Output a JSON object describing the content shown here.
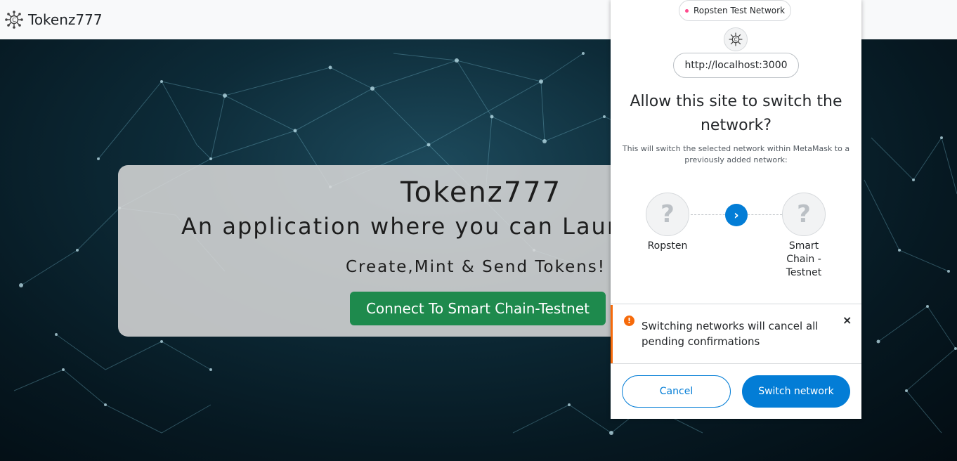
{
  "navbar": {
    "brand": "Tokenz777",
    "logo_icon": "network-hub-icon"
  },
  "hero": {
    "title": "Tokenz777",
    "subtitle": "An application where you can Laun",
    "tagline": "Create,Mint & Send Tokens!",
    "connect_button": "Connect To Smart Chain-Testnet"
  },
  "metamask": {
    "network_pill": "Ropsten Test Network",
    "origin": "http://localhost:3000",
    "title_line1": "Allow this site to switch the",
    "title_line2": "network?",
    "description": "This will switch the selected network within MetaMask to a previously added network:",
    "from_network": {
      "label": "Ropsten",
      "icon": "?"
    },
    "to_network": {
      "label_lines": [
        "Smart",
        "Chain -",
        "Testnet"
      ],
      "icon": "?"
    },
    "warning_text": "Switching networks will cancel all pending confirmations",
    "warning_icon": "!",
    "close_glyph": "×",
    "cancel_button": "Cancel",
    "switch_button": "Switch network",
    "colors": {
      "primary": "#037dd6",
      "warning": "#f66a0a",
      "network_dot": "#ff4a8d"
    }
  }
}
